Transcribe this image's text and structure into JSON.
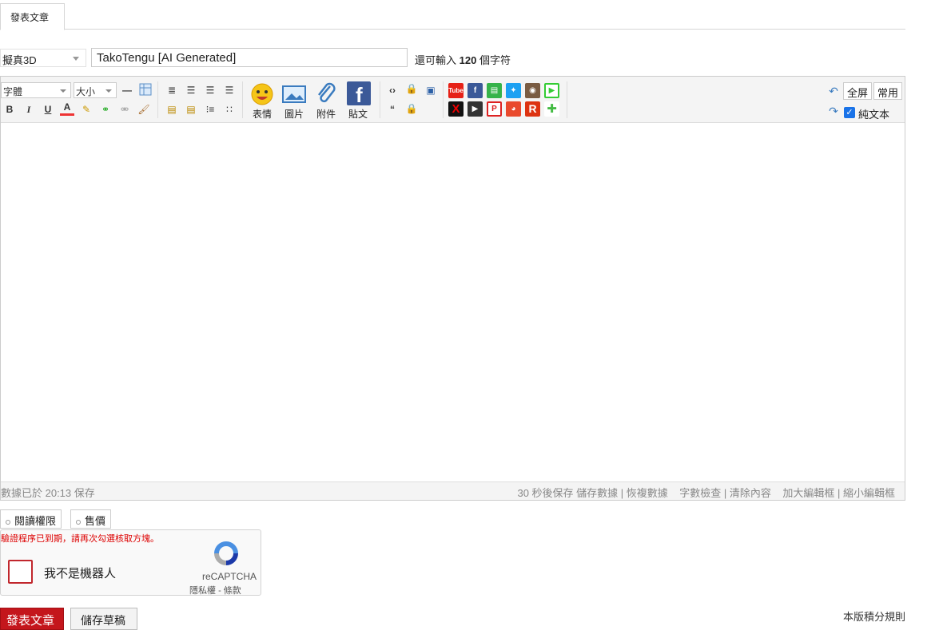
{
  "tabs": [
    {
      "label": "發表文章"
    }
  ],
  "post": {
    "type_value": "擬真3D",
    "subject_value": "TakoTengu [AI Generated]",
    "remain_prefix": "還可輸入",
    "remain_count": "120",
    "remain_suffix": "個字符"
  },
  "toolbar": {
    "font_label": "字體",
    "size_label": "大小",
    "bold": "B",
    "italic": "I",
    "underline": "U",
    "color": "A",
    "emoji_label": "表情",
    "image_label": "圖片",
    "attach_label": "附件",
    "fbpost_label": "貼文",
    "fullscreen_label": "全屏",
    "common_label": "常用",
    "plaintext_label": "純文本",
    "plaintext_checked": true,
    "accent_color": "#3b5998"
  },
  "status": {
    "saved_text": "數據已於 20:13 保存",
    "autosave_text": "30 秒後保存",
    "save_data": "儲存數據",
    "restore_data": "恢複數據",
    "word_check": "字數檢查",
    "clear_content": "清除內容",
    "enlarge": "加大編輯框",
    "shrink": "縮小編輯框"
  },
  "options": [
    {
      "label": "閱讀權限"
    },
    {
      "label": "售價"
    }
  ],
  "captcha": {
    "error": "驗證程序已到期，請再次勾選核取方塊。",
    "label": "我不是機器人",
    "brand": "reCAPTCHA",
    "privacy": "隱私權",
    "terms": "條款",
    "terms_sep": "-"
  },
  "actions": {
    "submit_label": "發表文章",
    "draft_label": "儲存草稿",
    "rules_label": "本版積分規則",
    "submit_color": "#c4161c"
  }
}
